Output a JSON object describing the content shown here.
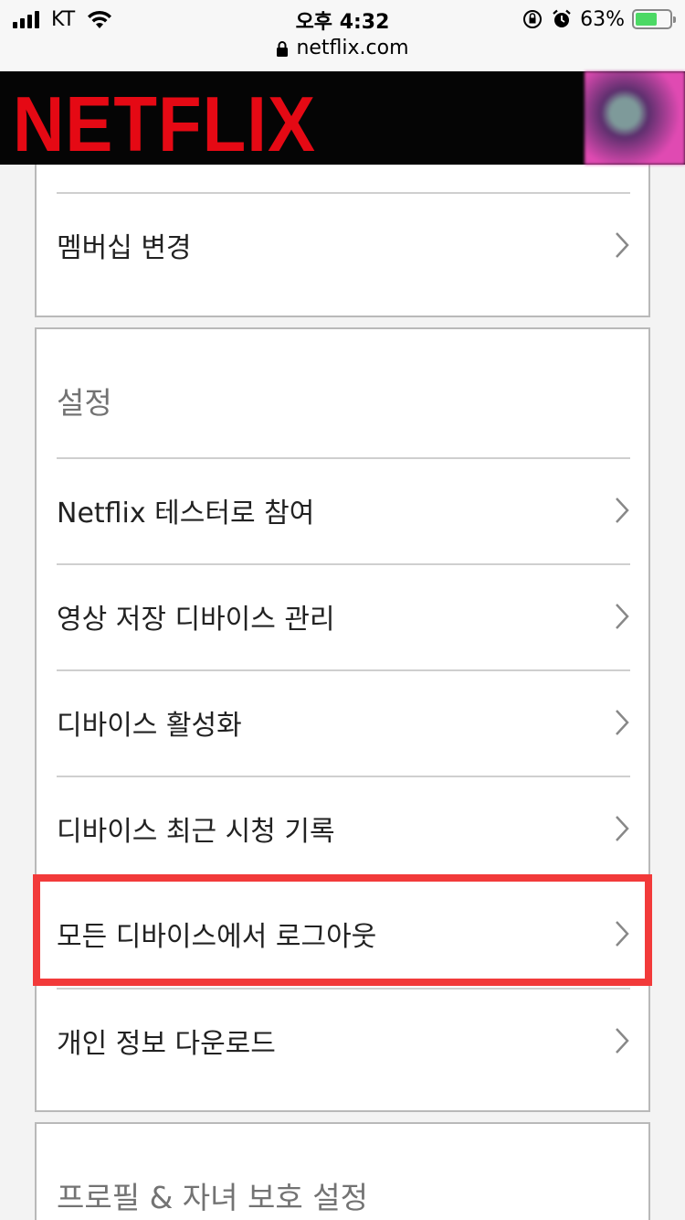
{
  "status_bar": {
    "carrier": "KT",
    "time": "오후 4:32",
    "battery_percent": "63%",
    "url": "netflix.com",
    "battery_level": 0.63
  },
  "header": {
    "logo_text": "NETFLIX",
    "brand_color": "#e50914"
  },
  "membership_card": {
    "items": [
      {
        "label": "멤버십 변경",
        "icon": "chevron-right-icon"
      }
    ]
  },
  "settings": {
    "title": "설정",
    "items": [
      {
        "label": "Netflix 테스터로 참여",
        "icon": "chevron-right-icon"
      },
      {
        "label": "영상 저장 디바이스 관리",
        "icon": "chevron-right-icon"
      },
      {
        "label": "디바이스 활성화",
        "icon": "chevron-right-icon"
      },
      {
        "label": "디바이스 최근 시청 기록",
        "icon": "chevron-right-icon"
      },
      {
        "label": "모든 디바이스에서 로그아웃",
        "icon": "chevron-right-icon"
      },
      {
        "label": "개인 정보 다운로드",
        "icon": "chevron-right-icon"
      }
    ]
  },
  "profile_section": {
    "title": "프로필 & 자녀 보호 설정"
  },
  "highlight_color": "#f23a3a"
}
